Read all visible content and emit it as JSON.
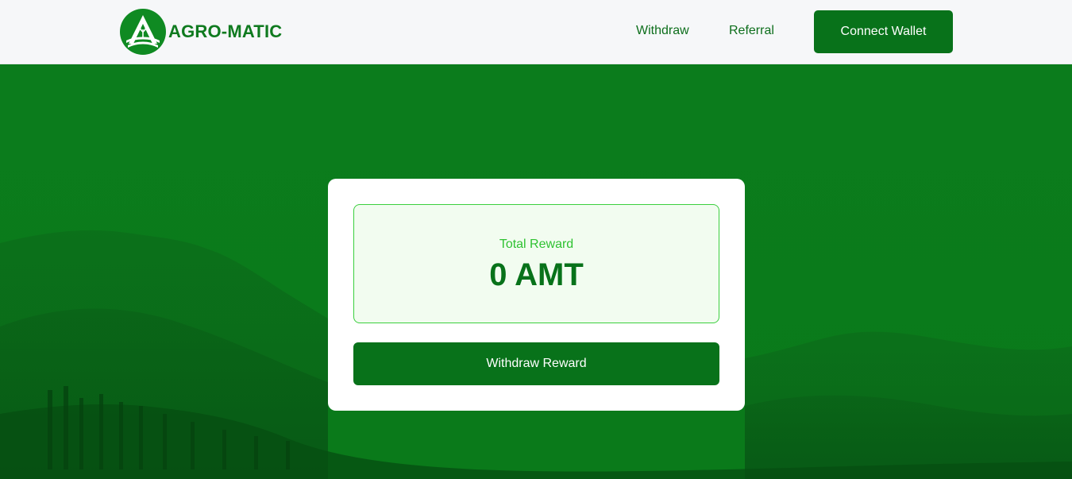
{
  "brand": {
    "name": "AGRO-MATIC",
    "logo_icon": "agro-matic-logo-icon"
  },
  "nav": {
    "links": [
      {
        "label": "Withdraw"
      },
      {
        "label": "Referral"
      }
    ],
    "connect_wallet_label": "Connect Wallet"
  },
  "reward": {
    "label": "Total Reward",
    "value": "0 AMT",
    "withdraw_label": "Withdraw Reward"
  },
  "colors": {
    "primary_green": "#08721a",
    "accent_green": "#2fc232",
    "reward_box_bg": "#f2fcf0",
    "navbar_bg": "#f6f7f9"
  }
}
